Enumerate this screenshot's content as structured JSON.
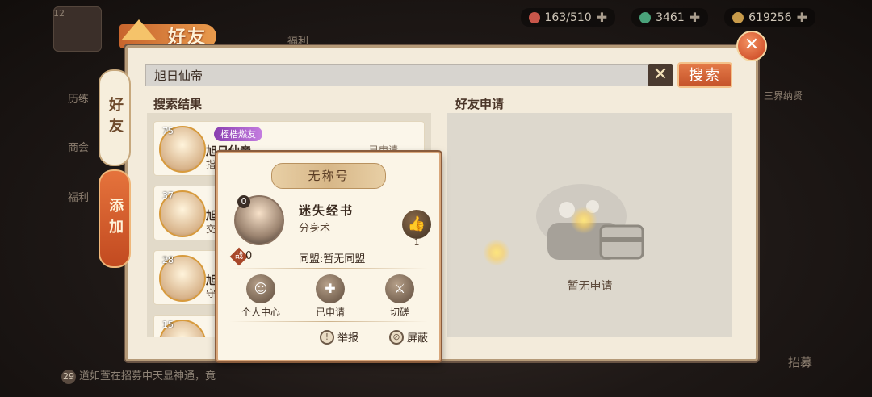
{
  "resources": [
    {
      "value": "163/510",
      "color": "#c8564a"
    },
    {
      "value": "3461",
      "color": "#4aa27a"
    },
    {
      "value": "619256",
      "color": "#c89b4a"
    }
  ],
  "background": {
    "left_items": [
      "12",
      "历练",
      "商会",
      "福利"
    ],
    "top_items": [
      "福利"
    ],
    "right_items": [
      "三界纳贤"
    ],
    "bottom_items": [
      "招募"
    ],
    "notice_number": "29",
    "notice_text": "道如萱在招募中天显神通，竟"
  },
  "window": {
    "title": "好友",
    "close_label": "✕"
  },
  "tabs": [
    {
      "label": "好友",
      "active": true
    },
    {
      "label": "添加",
      "active": false
    }
  ],
  "search": {
    "value": "旭日仙帝",
    "clear_label": "✕",
    "button_label": "搜索"
  },
  "results_title": "搜索结果",
  "requests_title": "好友申请",
  "results": [
    {
      "level": "75",
      "badge": "桎梏燃友",
      "name": "旭日仙帝",
      "sub": "指",
      "status": "已申请"
    },
    {
      "level": "37",
      "name": "旭",
      "sub": "交"
    },
    {
      "level": "28",
      "name": "旭",
      "sub": "守"
    },
    {
      "level": "15",
      "name": "旭",
      "sub": ""
    }
  ],
  "requests_empty": "暂无申请",
  "profile_card": {
    "title": "无称号",
    "level": "0",
    "name": "迷失经书",
    "subtitle": "分身术",
    "likes": "1",
    "power_icon": "战",
    "power": "0",
    "alliance": "同盟:暂无同盟",
    "actions": [
      {
        "label": "个人中心",
        "icon": "person-icon"
      },
      {
        "label": "已申请",
        "icon": "add-friend-icon"
      },
      {
        "label": "切磋",
        "icon": "sword-icon"
      }
    ],
    "report_label": "举报",
    "block_label": "屏蔽"
  }
}
